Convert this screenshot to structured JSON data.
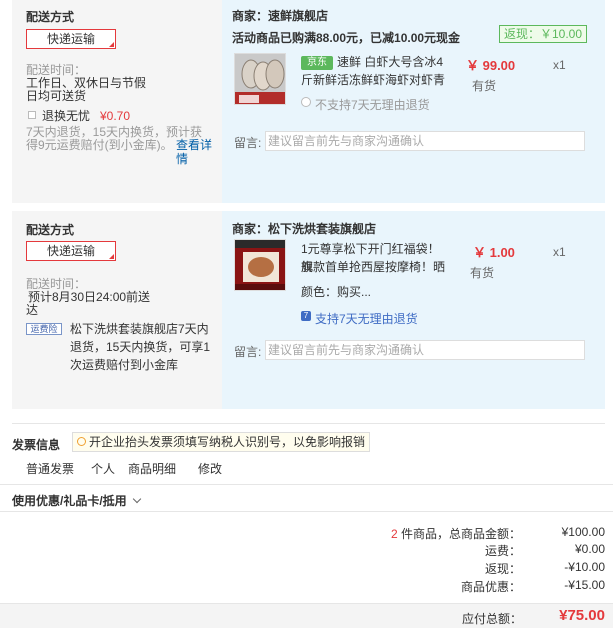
{
  "orders": [
    {
      "ship_title": "配送方式",
      "ship_method": "快递运输",
      "ship_time_label": "配送时间：",
      "ship_time_lines": [
        "工作日、双休日与节假",
        "日均可送货"
      ],
      "return_ins": {
        "label": "退换无忧",
        "price": "¥0.70"
      },
      "return_desc": [
        "7天内退货，15天内换货，预计获",
        "得9元运费赔付(到小金库)。"
      ],
      "return_link": "查看详情",
      "merchant": "商家：速鲜旗舰店",
      "promo": "活动商品已购满88.00元，已减10.00元现金",
      "rebate": "返现：￥10.00",
      "item": {
        "badge": "京东",
        "name_lines": [
          "速鲜 白虾大号含冰4",
          "斤新鲜活冻鲜虾海虾对虾青"
        ],
        "price": "￥ 99.00",
        "stock": "有货",
        "qty": "x1",
        "service": "不支持7天无理由退货"
      },
      "note_label": "留言:",
      "note_placeholder": "建议留言前先与商家沟通确认"
    },
    {
      "ship_title": "配送方式",
      "ship_method": "快递运输",
      "ship_time_label": "配送时间：",
      "ship_time_lines": [
        "预计8月30日24:00前送",
        "达"
      ],
      "carrier_logo": "运费险",
      "carrier_desc": [
        "松下洗烘套装旗舰店7天内",
        "退货，15天内换货，可享1",
        "次运费赔付到小金库"
      ],
      "merchant": "商家：松下洗烘套装旗舰店",
      "item": {
        "name_lines": [
          "1元尊享松下开门红福袋！旗",
          "舰款首单抢西屋按摩椅！晒"
        ],
        "attr": "颜色：购买...",
        "price": "￥ 1.00",
        "stock": "有货",
        "qty": "x1",
        "service": "支持7天无理由退货"
      },
      "note_label": "留言:",
      "note_placeholder": "建议留言前先与商家沟通确认"
    }
  ],
  "invoice": {
    "title": "发票信息",
    "tip": "开企业抬头发票须填写纳税人识别号，以免影响报销",
    "type": "普通发票",
    "holder": "个人",
    "content": "商品明细",
    "edit": "修改"
  },
  "coupon_title": "使用优惠/礼品卡/抵用",
  "summary": {
    "count": "2",
    "count_label": "件商品，总商品金额：",
    "goods_total": "¥100.00",
    "shipping_label": "运费：",
    "shipping": "¥0.00",
    "rebate_label": "返现：",
    "rebate": "-¥10.00",
    "discount_label": "商品优惠：",
    "discount": "-¥15.00",
    "payable_label": "应付总额：",
    "payable": "¥75.00"
  }
}
